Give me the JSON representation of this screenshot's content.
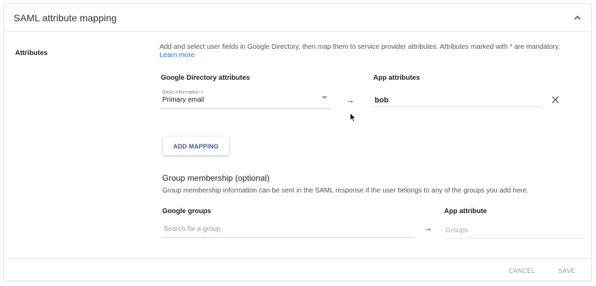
{
  "header": {
    "title": "SAML attribute mapping",
    "collapse_icon": "chevron-up-icon"
  },
  "attributes": {
    "label": "Attributes",
    "description": "Add and select user fields in Google Directory, then map them to service provider attributes. Attributes marked with * are mandatory.",
    "learn_more": "Learn more",
    "directory_header": "Google Directory attributes",
    "app_header": "App attributes",
    "mapping": {
      "category": "Basic Information >",
      "field": "Primary email",
      "arrow": "→",
      "app_value": "bob",
      "remove_icon": "close-icon"
    },
    "add_mapping_label": "ADD MAPPING"
  },
  "group_membership": {
    "title": "Group membership (optional)",
    "description": "Group membership information can be sent in the SAML response if the user belongs to any of the groups you add here.",
    "groups_header": "Google groups",
    "groups_placeholder": "Search for a group",
    "arrow": "→",
    "app_attribute_header": "App attribute",
    "app_attribute_placeholder": "Groups"
  },
  "footer": {
    "cancel_label": "CANCEL",
    "save_label": "SAVE"
  },
  "colors": {
    "link": "#1a73e8",
    "button_text": "#3c5a99",
    "disabled_text": "#999999"
  }
}
